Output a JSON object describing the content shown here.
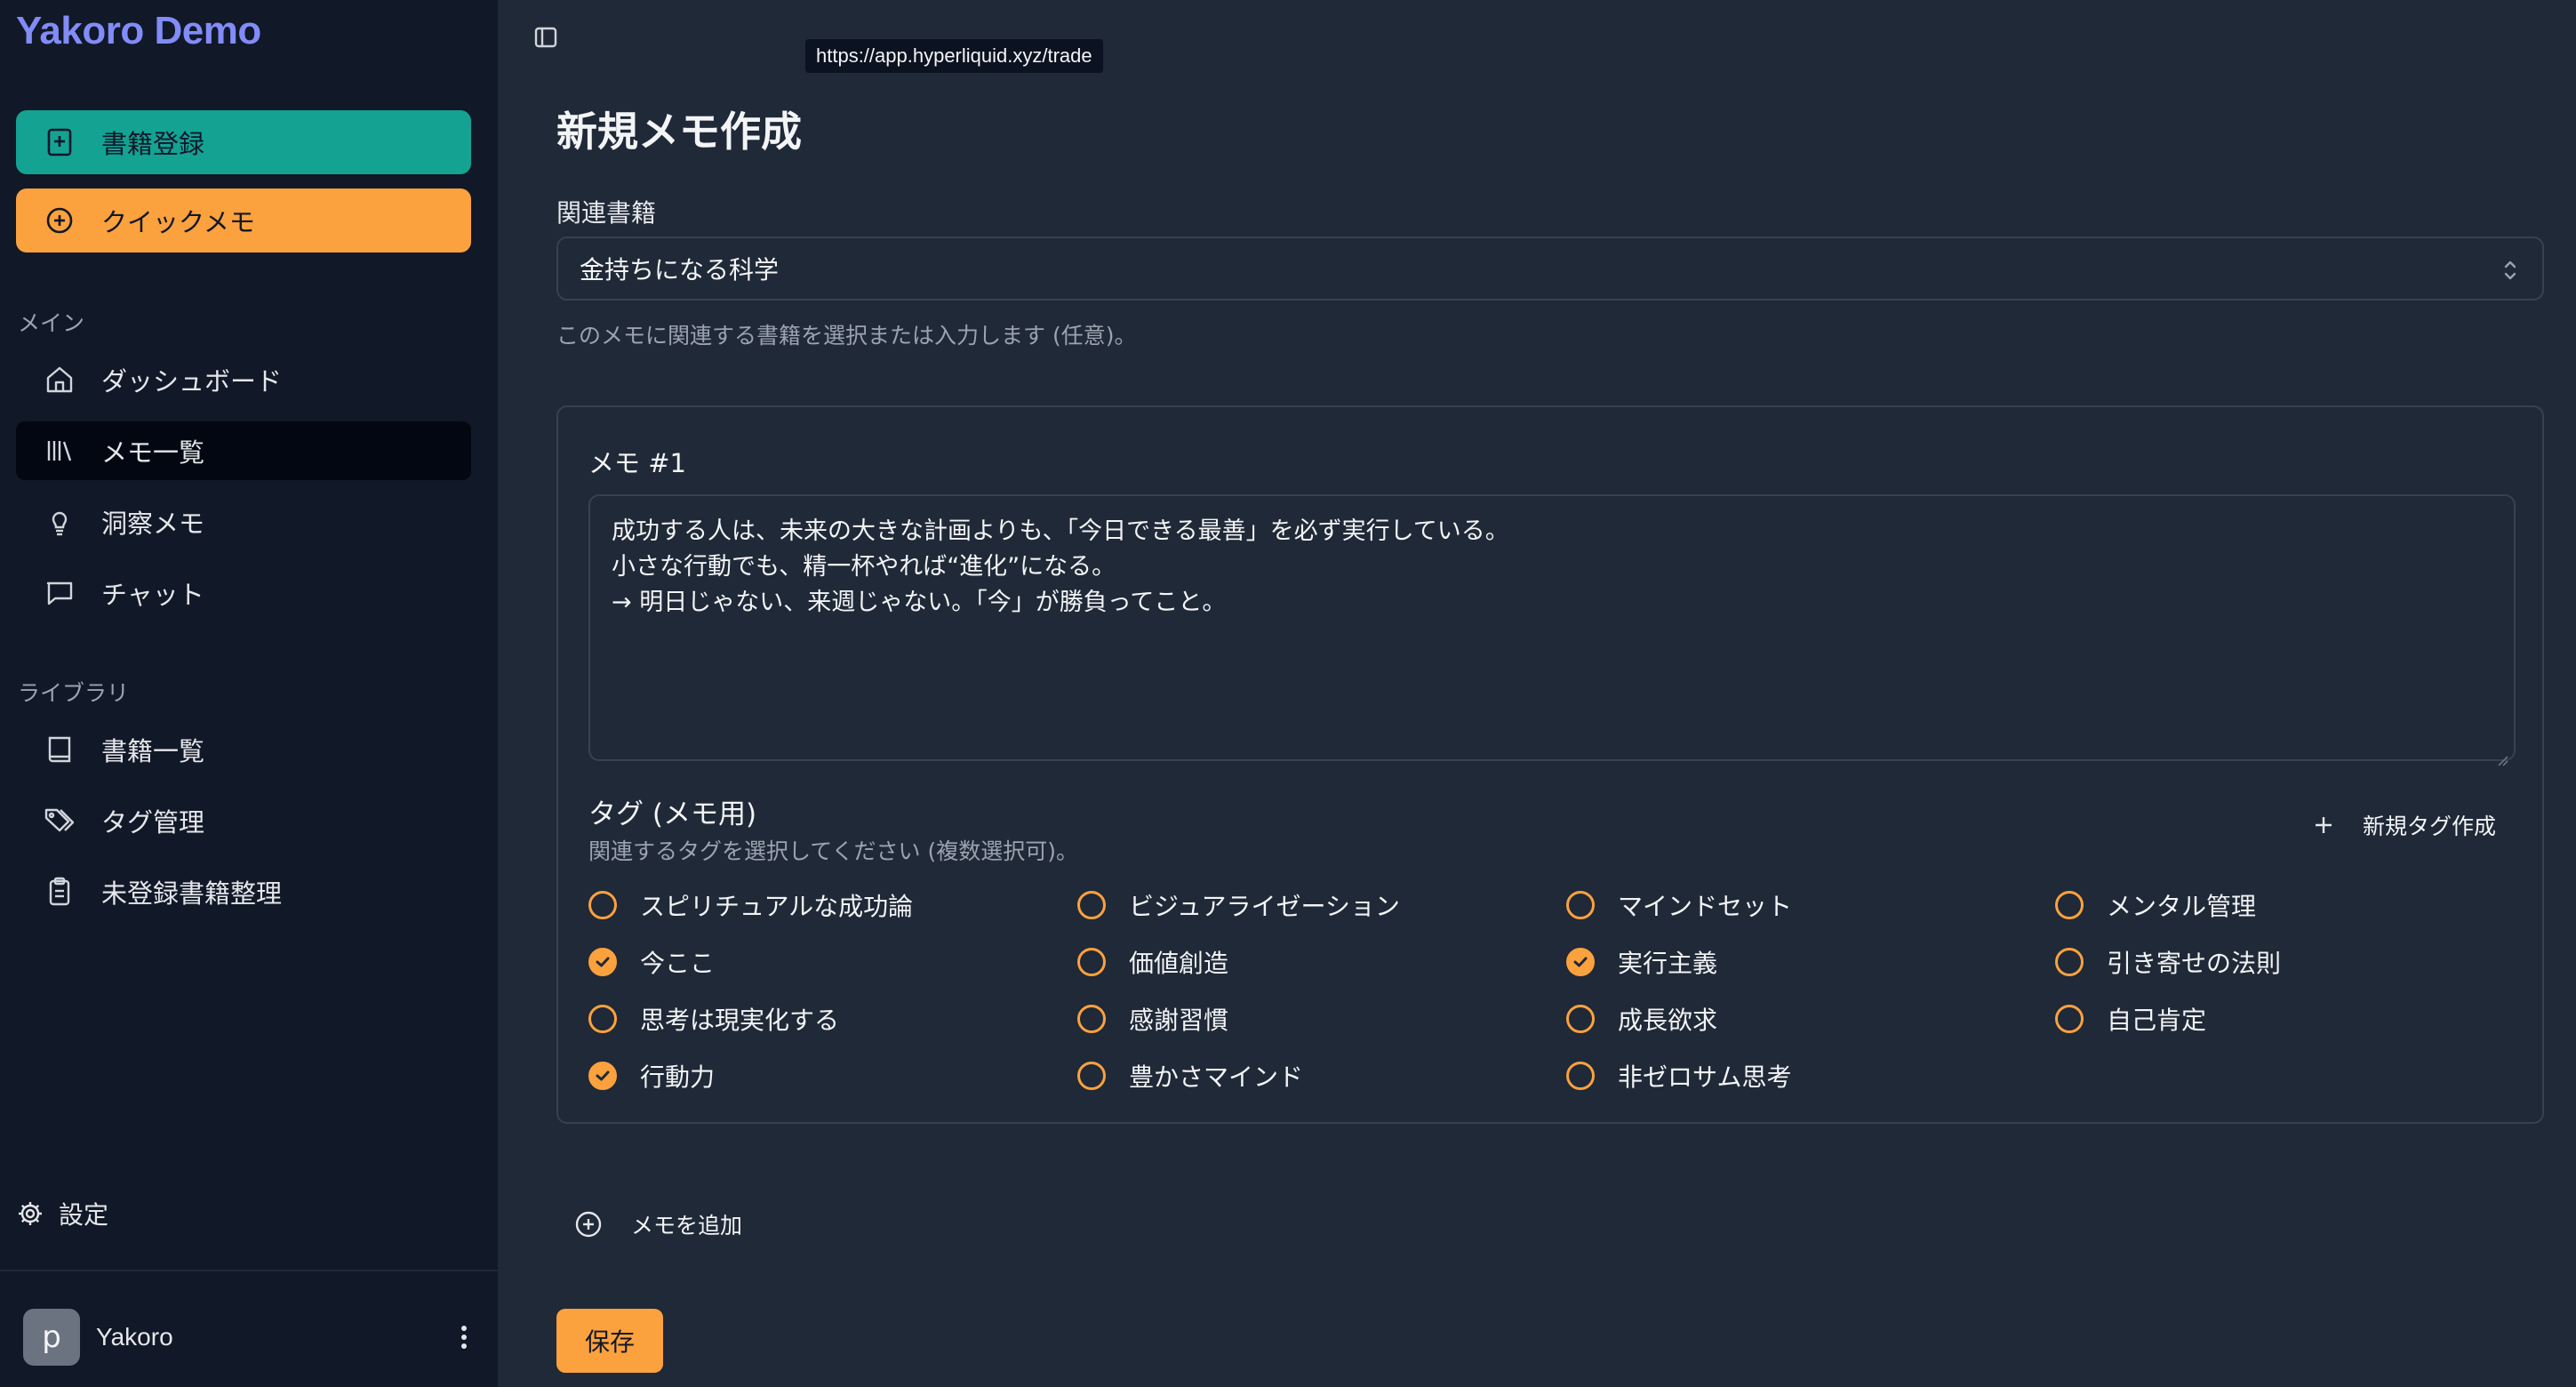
{
  "app": {
    "brand": "Yakoro Demo"
  },
  "sidebar": {
    "primary_buttons": [
      {
        "label": "書籍登録",
        "icon": "book-plus-icon",
        "color": "#14a292"
      },
      {
        "label": "クイックメモ",
        "icon": "plus-circle-icon",
        "color": "#fba13e"
      }
    ],
    "sections": [
      {
        "title": "メイン",
        "items": [
          {
            "label": "ダッシュボード",
            "icon": "home-icon",
            "active": false
          },
          {
            "label": "メモ一覧",
            "icon": "library-icon",
            "active": true
          },
          {
            "label": "洞察メモ",
            "icon": "lightbulb-icon",
            "active": false
          },
          {
            "label": "チャット",
            "icon": "chat-icon",
            "active": false
          }
        ]
      },
      {
        "title": "ライブラリ",
        "items": [
          {
            "label": "書籍一覧",
            "icon": "book-icon",
            "active": false
          },
          {
            "label": "タグ管理",
            "icon": "tags-icon",
            "active": false
          },
          {
            "label": "未登録書籍整理",
            "icon": "clipboard-icon",
            "active": false
          }
        ]
      }
    ],
    "settings_label": "設定",
    "user": {
      "avatar_letter": "p",
      "name": "Yakoro"
    }
  },
  "main": {
    "url_tooltip": "https://app.hyperliquid.xyz/trade",
    "title": "新規メモ作成",
    "related_book": {
      "label": "関連書籍",
      "value": "金持ちになる科学",
      "help": "このメモに関連する書籍を選択または入力します (任意)。"
    },
    "memo": {
      "title": "メモ #1",
      "lines": [
        "成功する人は、未来の大きな計画よりも、「今日できる最善」を必ず実行している。",
        "小さな行動でも、精一杯やれば“進化”になる。",
        "→ 明日じゃない、来週じゃない。「今」が勝負ってこと。"
      ],
      "tags_title": "タグ (メモ用)",
      "tags_help": "関連するタグを選択してください (複数選択可)。",
      "new_tag_label": "新規タグ作成",
      "tags": [
        {
          "label": "スピリチュアルな成功論",
          "checked": false
        },
        {
          "label": "ビジュアライゼーション",
          "checked": false
        },
        {
          "label": "マインドセット",
          "checked": false
        },
        {
          "label": "メンタル管理",
          "checked": false
        },
        {
          "label": "今ここ",
          "checked": true
        },
        {
          "label": "価値創造",
          "checked": false
        },
        {
          "label": "実行主義",
          "checked": true
        },
        {
          "label": "引き寄せの法則",
          "checked": false
        },
        {
          "label": "思考は現実化する",
          "checked": false
        },
        {
          "label": "感謝習慣",
          "checked": false
        },
        {
          "label": "成長欲求",
          "checked": false
        },
        {
          "label": "自己肯定",
          "checked": false
        },
        {
          "label": "行動力",
          "checked": true
        },
        {
          "label": "豊かさマインド",
          "checked": false
        },
        {
          "label": "非ゼロサム思考",
          "checked": false
        }
      ]
    },
    "add_memo_label": "メモを追加",
    "save_label": "保存"
  },
  "colors": {
    "accent_orange": "#fba13e",
    "accent_teal": "#14a292",
    "brand": "#818cf8"
  }
}
